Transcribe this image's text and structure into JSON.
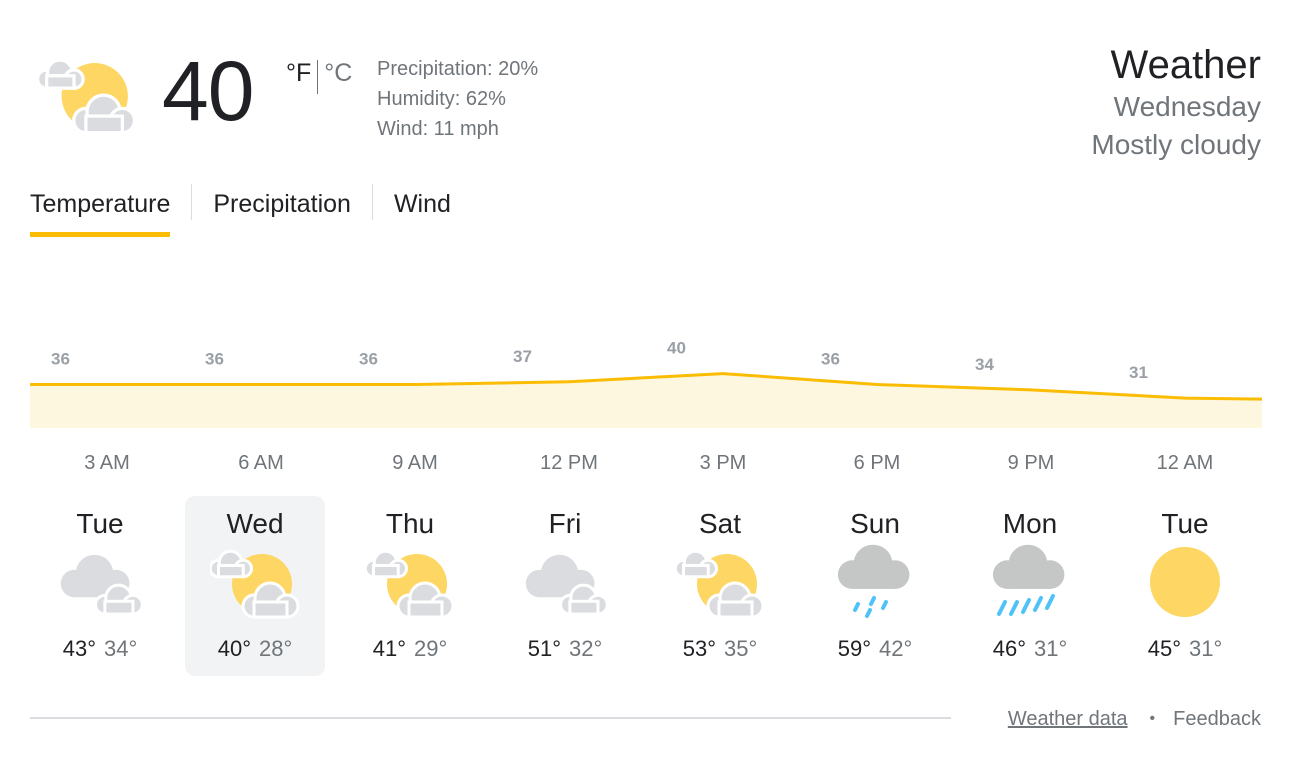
{
  "current": {
    "icon": "partly-cloudy-icon",
    "temperature": "40",
    "unit_f": "°F",
    "unit_c": "°C",
    "precipitation": "Precipitation: 20%",
    "humidity": "Humidity: 62%",
    "wind": "Wind: 11 mph"
  },
  "header": {
    "title": "Weather",
    "day": "Wednesday",
    "condition": "Mostly cloudy"
  },
  "tabs": [
    {
      "label": "Temperature",
      "active": true
    },
    {
      "label": "Precipitation",
      "active": false
    },
    {
      "label": "Wind",
      "active": false
    }
  ],
  "chart_data": {
    "type": "area",
    "x": [
      "3 AM",
      "6 AM",
      "9 AM",
      "12 PM",
      "3 PM",
      "6 PM",
      "9 PM",
      "12 AM"
    ],
    "values": [
      36,
      36,
      36,
      37,
      40,
      36,
      34,
      31
    ],
    "line_color": "#fbbc04",
    "fill_color": "#fef7e0"
  },
  "hours": [
    "3 AM",
    "6 AM",
    "9 AM",
    "12 PM",
    "3 PM",
    "6 PM",
    "9 PM",
    "12 AM"
  ],
  "days": [
    {
      "name": "Tue",
      "icon": "cloudy-icon",
      "high": "43°",
      "low": "34°",
      "selected": false
    },
    {
      "name": "Wed",
      "icon": "partly-cloudy-icon",
      "high": "40°",
      "low": "28°",
      "selected": true
    },
    {
      "name": "Thu",
      "icon": "partly-cloudy-icon",
      "high": "41°",
      "low": "29°",
      "selected": false
    },
    {
      "name": "Fri",
      "icon": "cloudy-icon",
      "high": "51°",
      "low": "32°",
      "selected": false
    },
    {
      "name": "Sat",
      "icon": "partly-cloudy-icon",
      "high": "53°",
      "low": "35°",
      "selected": false
    },
    {
      "name": "Sun",
      "icon": "light-rain-icon",
      "high": "59°",
      "low": "42°",
      "selected": false
    },
    {
      "name": "Mon",
      "icon": "rain-icon",
      "high": "46°",
      "low": "31°",
      "selected": false
    },
    {
      "name": "Tue",
      "icon": "sunny-icon",
      "high": "45°",
      "low": "31°",
      "selected": false
    }
  ],
  "footer": {
    "data_link": "Weather data",
    "separator": "•",
    "feedback": "Feedback"
  },
  "colors": {
    "sun": "#fdd663",
    "cloud": "#dadce0",
    "rain": "#4fc3f7",
    "accent": "#fbbc04"
  }
}
